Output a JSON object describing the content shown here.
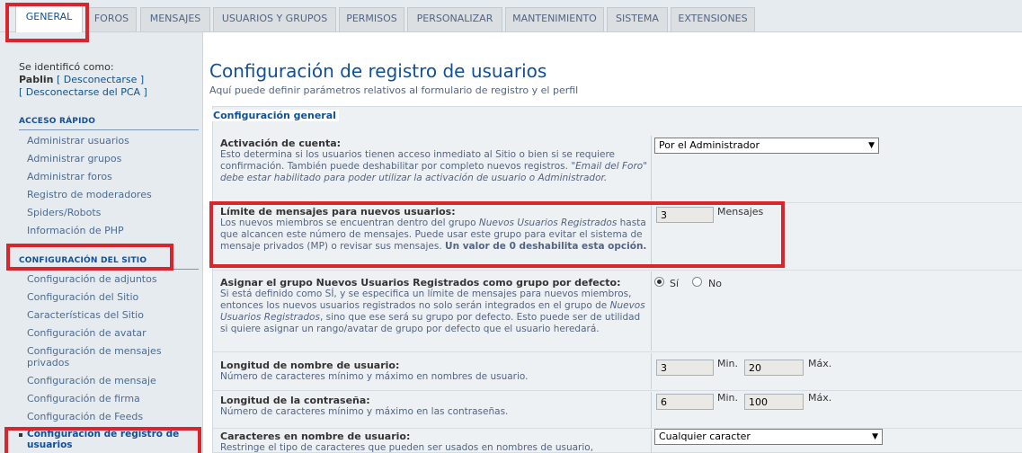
{
  "tabs": [
    {
      "label": "GENERAL",
      "active": true
    },
    {
      "label": "FOROS"
    },
    {
      "label": "MENSAJES"
    },
    {
      "label": "USUARIOS Y GRUPOS"
    },
    {
      "label": "PERMISOS"
    },
    {
      "label": "PERSONALIZAR"
    },
    {
      "label": "MANTENIMIENTO"
    },
    {
      "label": "SISTEMA"
    },
    {
      "label": "EXTENSIONES"
    }
  ],
  "sidebar": {
    "identified_as": "Se identificó como:",
    "username": "Pablin",
    "logout": "[ Desconectarse ]",
    "logout_acp": "[ Desconectarse del PCA ]",
    "quick_access": {
      "heading": "ACCESO RÁPIDO",
      "items": [
        "Administrar usuarios",
        "Administrar grupos",
        "Administrar foros",
        "Registro de moderadores",
        "Spiders/Robots",
        "Información de PHP"
      ]
    },
    "site_config": {
      "heading": "CONFIGURACIÓN DEL SITIO",
      "items": [
        "Configuración de adjuntos",
        "Configuración del Sitio",
        "Características del Sitio",
        "Configuración de avatar",
        "Configuración de mensajes privados",
        "Configuración de mensaje",
        "Configuración de firma",
        "Configuración de Feeds",
        "Configuración de registro de usuarios"
      ]
    }
  },
  "main": {
    "title": "Configuración de registro de usuarios",
    "description": "Aquí puede definir parámetros relativos al formulario de registro y el perfil",
    "legend": "Configuración general",
    "activation": {
      "title": "Activación de cuenta:",
      "desc_1": "Esto determina si los usuarios tienen acceso inmediato al Sitio o bien si se requiere confirmación. También puede deshabilitar por completo nuevos registros.",
      "desc_italic": "\"Email del Foro\" debe estar habilitado para poder utilizar la activación de usuario o Administrador.",
      "value": "Por el Administrador"
    },
    "post_limit": {
      "title": "Límite de mensajes para nuevos usuarios:",
      "desc_1": "Los nuevos miembros se encuentran dentro del grupo",
      "desc_group": "Nuevos Usuarios Registrados",
      "desc_2": "hasta que alcancen este número de mensajes. Puede usar este grupo para evitar el sistema de mensaje privados (MP) o revisar sus mensajes.",
      "desc_bold": "Un valor de 0 deshabilita esta opción.",
      "value": "3",
      "unit": "Mensajes"
    },
    "default_group": {
      "title": "Asignar el grupo Nuevos Usuarios Registrados como grupo por defecto:",
      "desc_1": "Si está definido como SÍ, y se especifica un límite de mensajes para nuevos miembros, entonces los nuevos usuarios registrados no solo serán integrados en el grupo de",
      "desc_group": "Nuevos Usuarios Registrados",
      "desc_2": ", sino que ese será su grupo por defecto. Esto puede ser de utilidad si quiere asignar un rango/avatar de grupo por defecto que el usuario heredará.",
      "yes": "Sí",
      "no": "No",
      "selected": "yes"
    },
    "username_length": {
      "title": "Longitud de nombre de usuario:",
      "desc": "Número de caracteres mínimo y máximo en nombres de usuario.",
      "min_value": "3",
      "min_label": "Min.",
      "max_value": "20",
      "max_label": "Máx."
    },
    "password_length": {
      "title": "Longitud de la contraseña:",
      "desc": "Número de caracteres mínimo y máximo en las contraseñas.",
      "min_value": "6",
      "min_label": "Min.",
      "max_value": "100",
      "max_label": "Máx."
    },
    "username_chars": {
      "title": "Caracteres en nombre de usuario:",
      "desc": "Restringe el tipo de caracteres que pueden ser usados en nombres de usuario,",
      "value": "Cualquier caracter"
    }
  },
  "colors": {
    "highlight": "#d9262c",
    "link": "#105289",
    "title": "#115098"
  }
}
